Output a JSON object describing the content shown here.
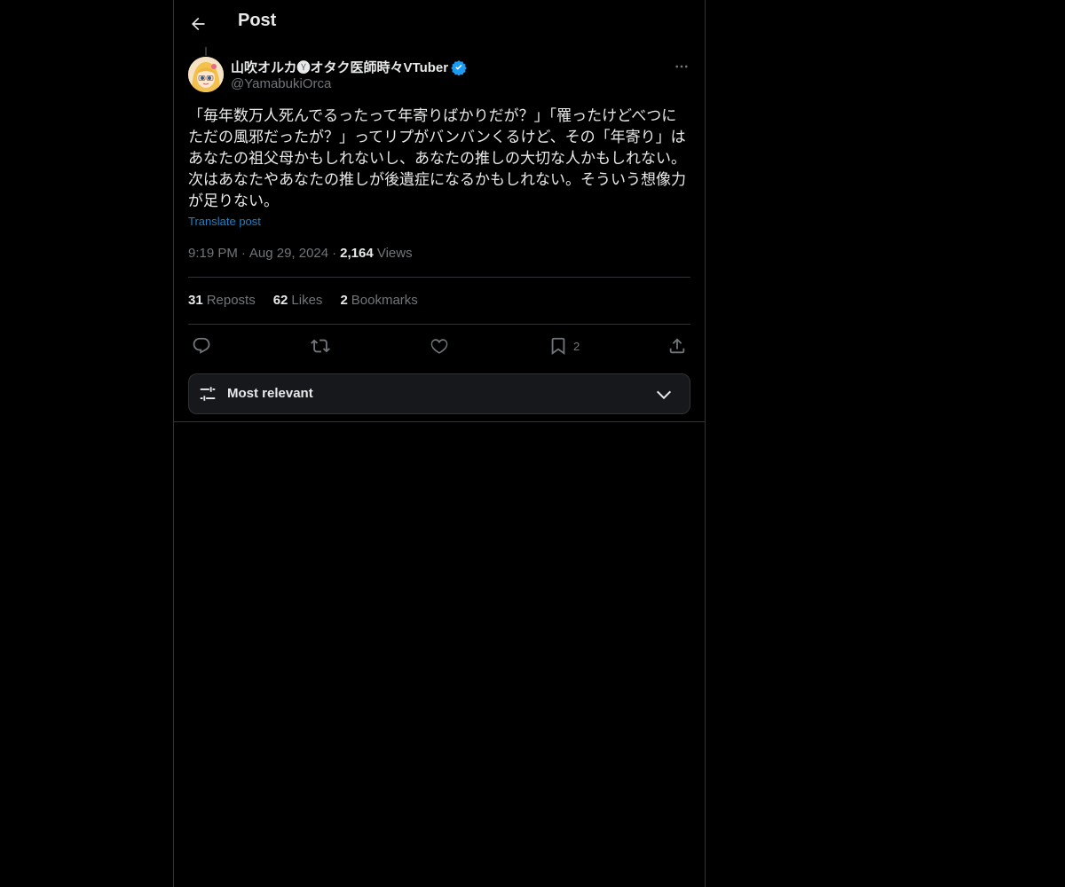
{
  "header": {
    "title": "Post",
    "back_icon": "arrow-left-icon"
  },
  "post": {
    "author_name": "山吹オルカ🅨オタク医師時々VTuber",
    "author_handle": "@YamabukiOrca",
    "verified": true,
    "text": "「毎年数万人死んでるったって年寄りばかりだが？」「罹ったけどべつにただの風邪だったが？」ってリプがバンバンくるけど、その「年寄り」はあなたの祖父母かもしれないし、あなたの推しの大切な人かもしれない。次はあなたやあなたの推しが後遺症になるかもしれない。そういう想像力が足りない。",
    "translate_label": "Translate post",
    "time": "9:19 PM",
    "date": "Aug 29, 2024",
    "views_count": "2,164",
    "views_label": "Views",
    "separator": "·"
  },
  "stats": {
    "reposts_count": "31",
    "reposts_label": "Reposts",
    "likes_count": "62",
    "likes_label": "Likes",
    "bookmarks_count": "2",
    "bookmarks_label": "Bookmarks"
  },
  "actions": {
    "bookmark_count": "2"
  },
  "sort": {
    "label": "Most relevant"
  },
  "colors": {
    "background": "#000000",
    "text": "#e7e9ea",
    "muted": "#71767b",
    "accent": "#1d9bf0",
    "border": "#2f3336"
  }
}
